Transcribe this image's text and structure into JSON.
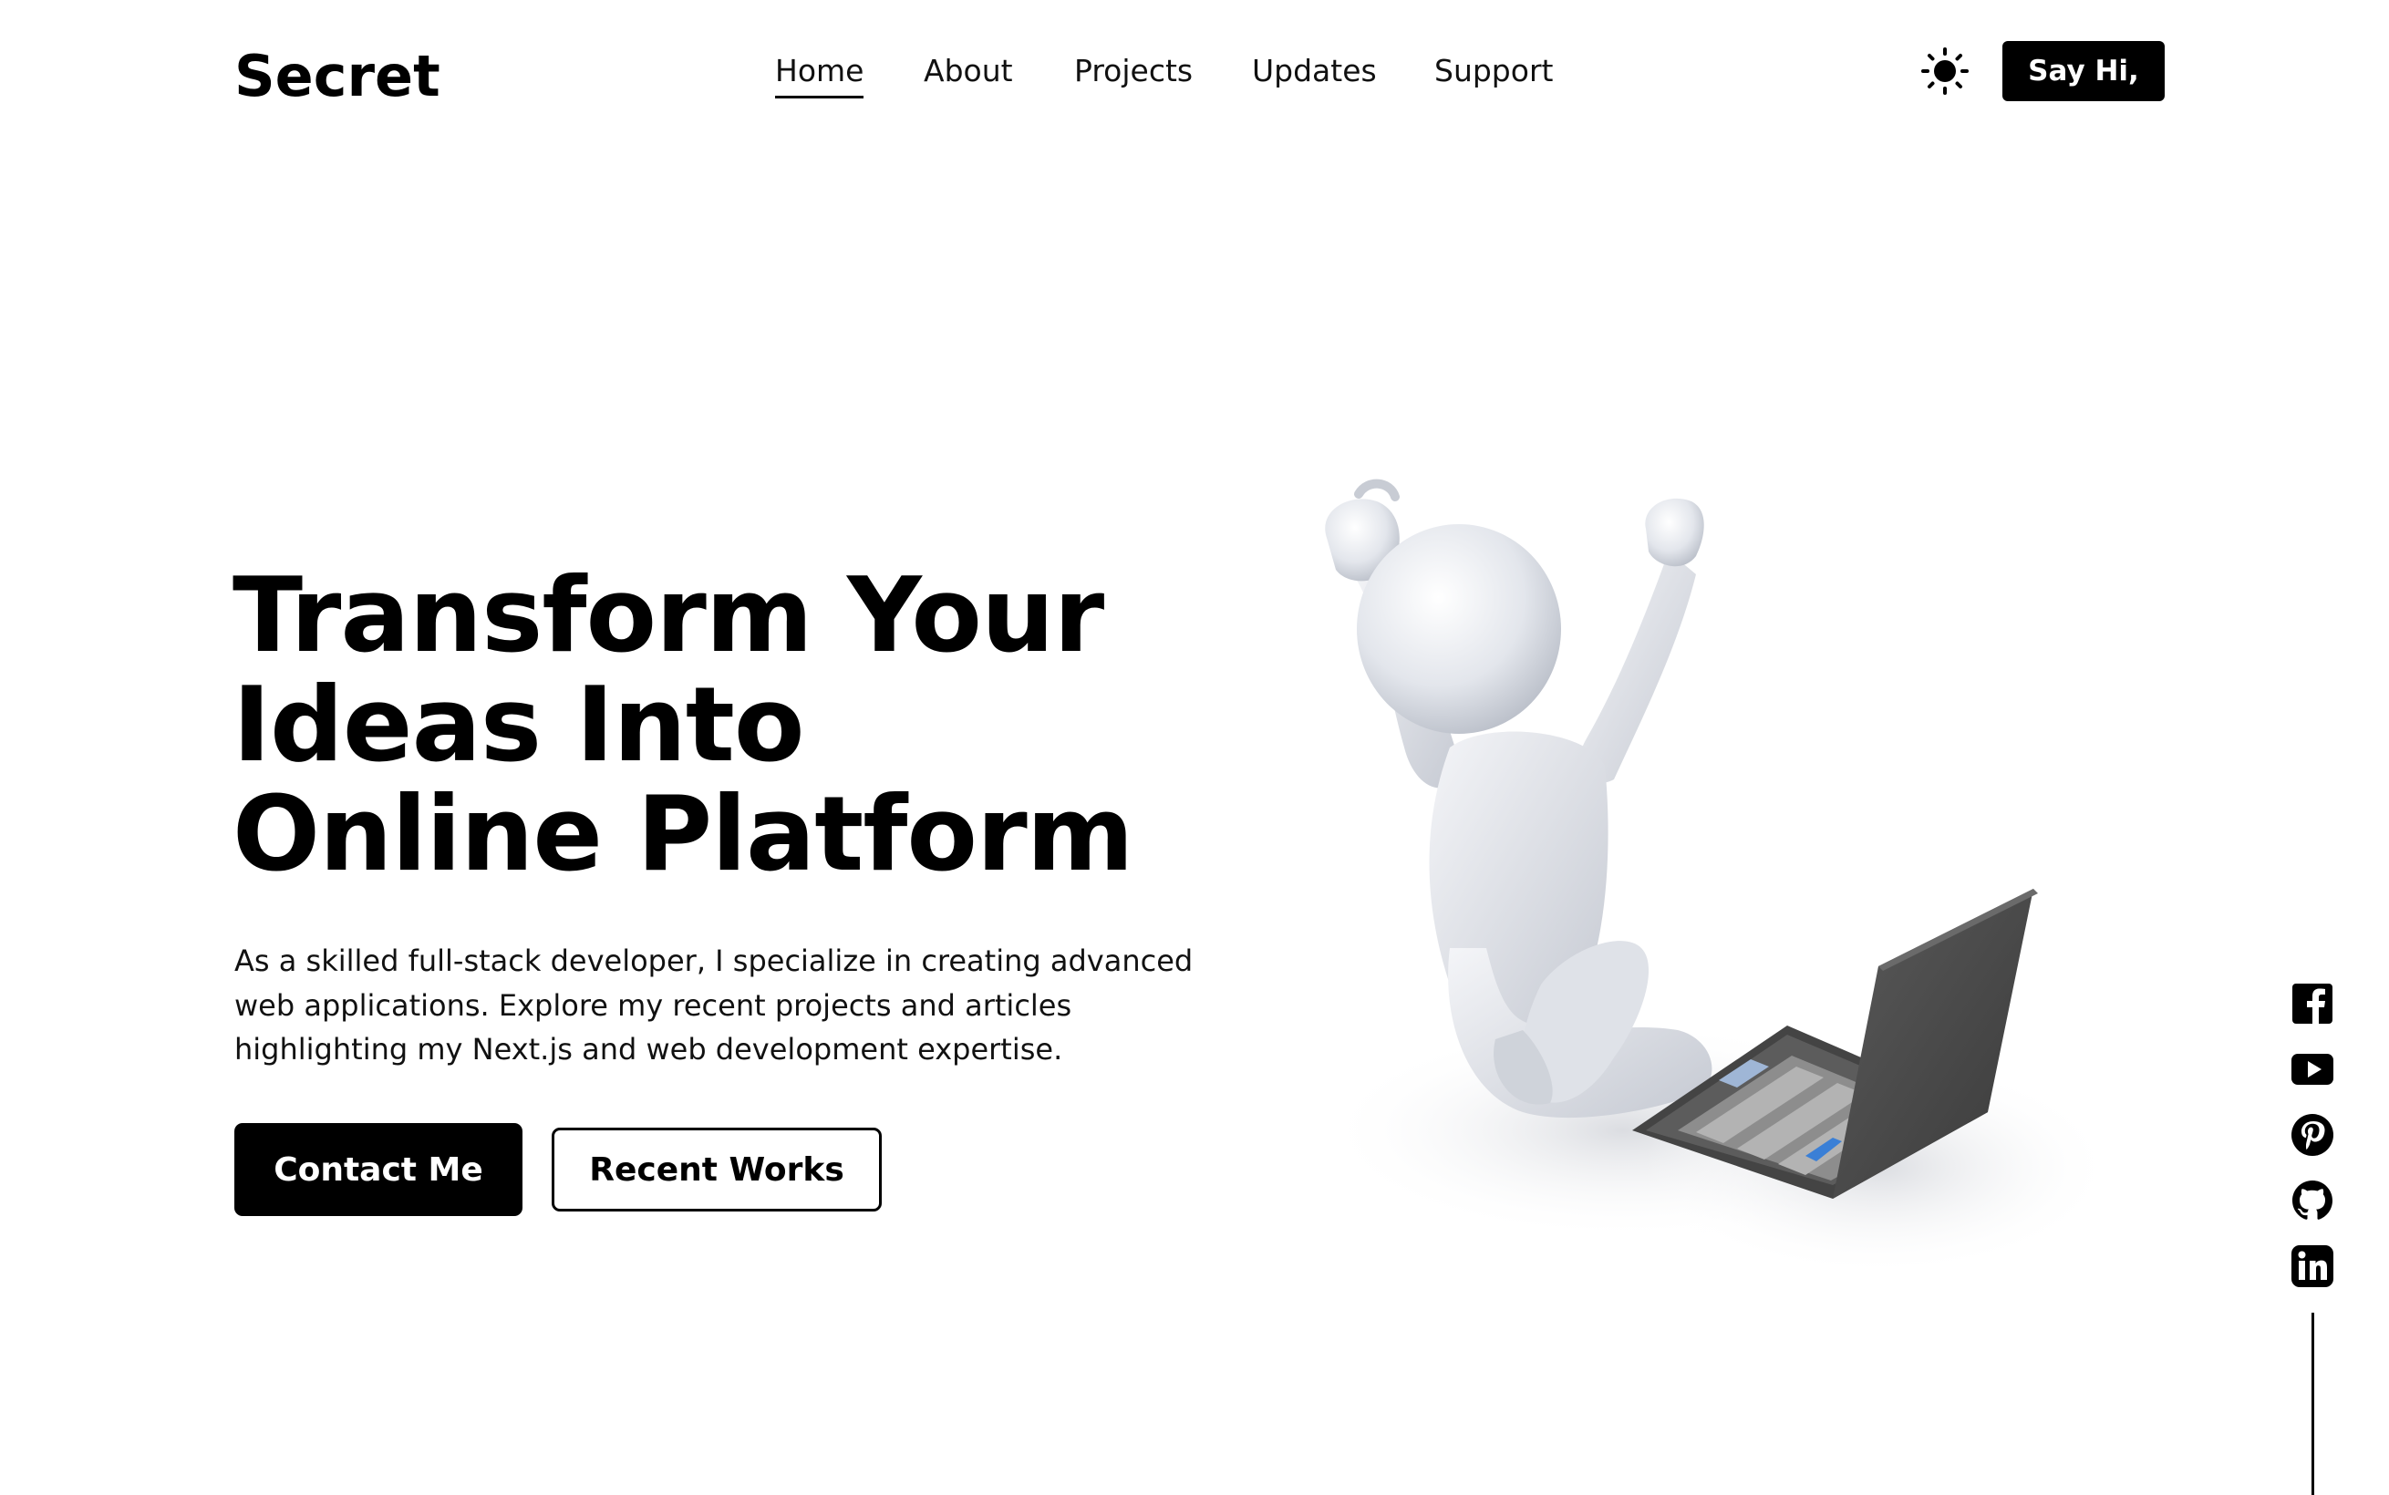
{
  "header": {
    "logo": "Secret",
    "nav": [
      {
        "label": "Home",
        "active": true
      },
      {
        "label": "About",
        "active": false
      },
      {
        "label": "Projects",
        "active": false
      },
      {
        "label": "Updates",
        "active": false
      },
      {
        "label": "Support",
        "active": false
      }
    ],
    "theme_toggle_icon": "sun-icon",
    "cta_label": "Say Hi,"
  },
  "hero": {
    "title_lines": [
      "Transform Your",
      "Ideas Into",
      "Online Platform"
    ],
    "description_lines": [
      "As a skilled full-stack developer, I specialize in creating advanced",
      "web applications. Explore my recent projects and articles",
      "highlighting my Next.js and web development expertise."
    ],
    "primary_button": "Contact Me",
    "secondary_button": "Recent Works",
    "illustration": "celebrating-stick-figure-with-laptop"
  },
  "social": {
    "icons": [
      "facebook-icon",
      "youtube-icon",
      "pinterest-icon",
      "github-icon",
      "linkedin-icon"
    ]
  },
  "colors": {
    "background": "#ffffff",
    "text": "#000000",
    "button_primary_bg": "#000000",
    "button_primary_text": "#ffffff"
  }
}
